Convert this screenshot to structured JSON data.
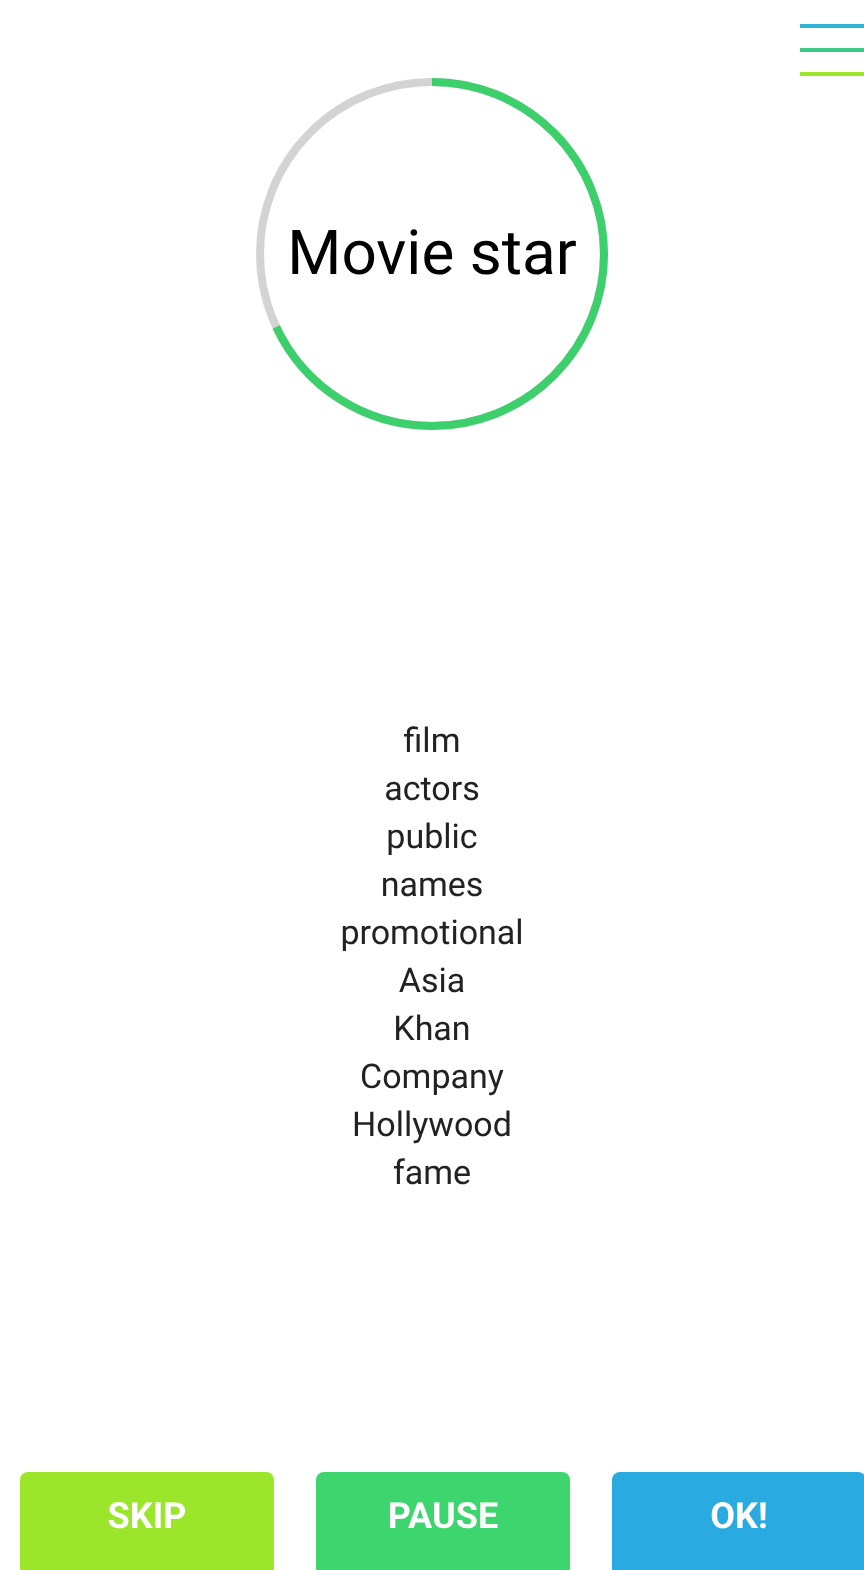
{
  "timer": {
    "word": "Movie star",
    "level": 0.68
  },
  "hints": [
    "film",
    "actors",
    "public",
    "names",
    "promotional",
    "Asia",
    "Khan",
    "Company",
    "Hollywood",
    "fame"
  ],
  "buttons": [
    {
      "label": "SKIP",
      "kind": "skip"
    },
    {
      "label": "PAUSE",
      "kind": "pause"
    },
    {
      "label": "OK!",
      "kind": "ok"
    }
  ]
}
